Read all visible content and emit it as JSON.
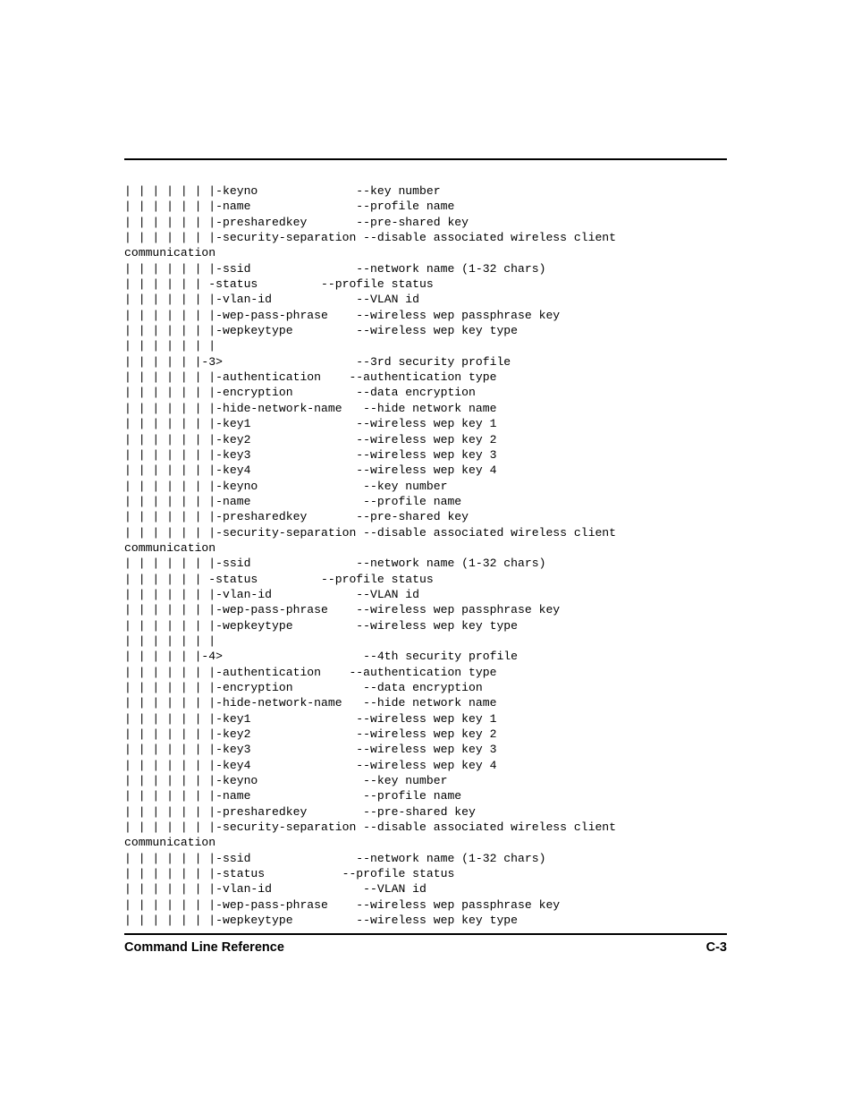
{
  "document": {
    "footer": {
      "title": "Command Line Reference",
      "page_number": "C-3"
    },
    "cli_tree": {
      "description": "Command line reference tree listing security profile options",
      "lines": [
        "| | | | | | |-keyno              --key number",
        "| | | | | | |-name               --profile name",
        "| | | | | | |-presharedkey       --pre-shared key",
        "| | | | | | |-security-separation --disable associated wireless client",
        "communication",
        "| | | | | | |-ssid               --network name (1-32 chars)",
        "| | | | | | -status         --profile status",
        "| | | | | | |-vlan-id            --VLAN id",
        "| | | | | | |-wep-pass-phrase    --wireless wep passphrase key",
        "| | | | | | |-wepkeytype         --wireless wep key type",
        "| | | | | | |",
        "| | | | | |-3>                   --3rd security profile",
        "| | | | | | |-authentication    --authentication type",
        "| | | | | | |-encryption         --data encryption",
        "| | | | | | |-hide-network-name   --hide network name",
        "| | | | | | |-key1               --wireless wep key 1",
        "| | | | | | |-key2               --wireless wep key 2",
        "| | | | | | |-key3               --wireless wep key 3",
        "| | | | | | |-key4               --wireless wep key 4",
        "| | | | | | |-keyno               --key number",
        "| | | | | | |-name                --profile name",
        "| | | | | | |-presharedkey       --pre-shared key",
        "| | | | | | |-security-separation --disable associated wireless client",
        "communication",
        "| | | | | | |-ssid               --network name (1-32 chars)",
        "| | | | | | -status         --profile status",
        "| | | | | | |-vlan-id            --VLAN id",
        "| | | | | | |-wep-pass-phrase    --wireless wep passphrase key",
        "| | | | | | |-wepkeytype         --wireless wep key type",
        "| | | | | | |",
        "| | | | | |-4>                    --4th security profile",
        "| | | | | | |-authentication    --authentication type",
        "| | | | | | |-encryption          --data encryption",
        "| | | | | | |-hide-network-name   --hide network name",
        "| | | | | | |-key1               --wireless wep key 1",
        "| | | | | | |-key2               --wireless wep key 2",
        "| | | | | | |-key3               --wireless wep key 3",
        "| | | | | | |-key4               --wireless wep key 4",
        "| | | | | | |-keyno               --key number",
        "| | | | | | |-name                --profile name",
        "| | | | | | |-presharedkey        --pre-shared key",
        "| | | | | | |-security-separation --disable associated wireless client",
        "communication",
        "| | | | | | |-ssid               --network name (1-32 chars)",
        "| | | | | | |-status           --profile status",
        "| | | | | | |-vlan-id             --VLAN id",
        "| | | | | | |-wep-pass-phrase    --wireless wep passphrase key",
        "| | | | | | |-wepkeytype         --wireless wep key type"
      ]
    }
  }
}
